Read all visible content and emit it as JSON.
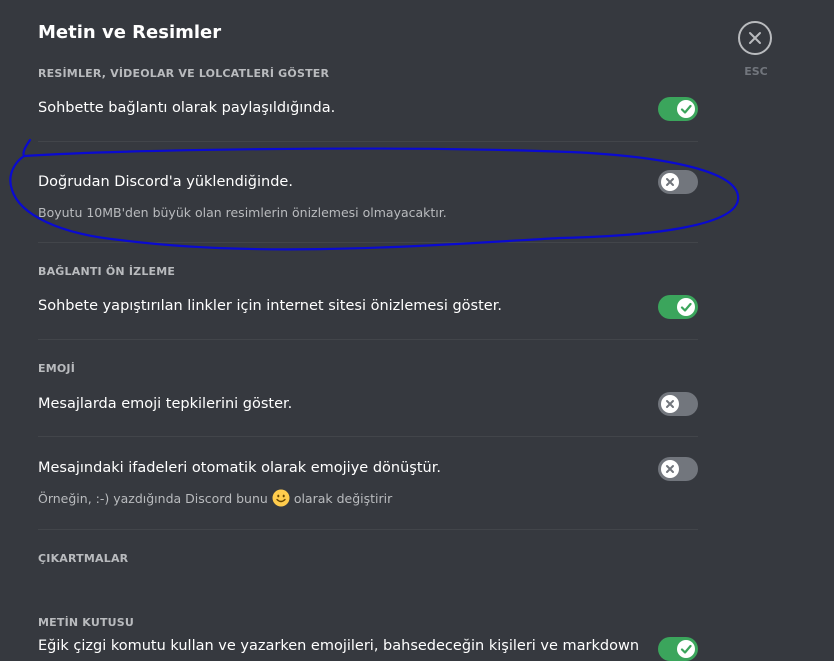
{
  "page": {
    "title": "Metin ve Resimler"
  },
  "close": {
    "esc_label": "ESC",
    "icon": "close-icon"
  },
  "sections": {
    "images": {
      "header": "RESİMLER, VİDEOLAR VE LOLCATLERİ GÖSTER",
      "link_setting": {
        "label": "Sohbette bağlantı olarak paylaşıldığında.",
        "enabled": true
      },
      "upload_setting": {
        "label": "Doğrudan Discord'a yüklendiğinde.",
        "description": "Boyutu 10MB'den büyük olan resimlerin önizlemesi olmayacaktır.",
        "enabled": false
      }
    },
    "link_preview": {
      "header": "BAĞLANTI ÖN İZLEME",
      "preview_setting": {
        "label": "Sohbete yapıştırılan linkler için internet sitesi önizlemesi göster.",
        "enabled": true
      }
    },
    "emoji": {
      "header": "EMOJİ",
      "reactions_setting": {
        "label": "Mesajlarda emoji tepkilerini göster.",
        "enabled": false
      },
      "convert_setting": {
        "label": "Mesajındaki ifadeleri otomatik olarak emojiye dönüştür.",
        "description_before": "Örneğin, :-) yazdığında Discord bunu",
        "description_after": "olarak değiştirir",
        "enabled": false
      }
    },
    "stickers": {
      "header": "ÇIKARTMALAR"
    },
    "textbox": {
      "header": "METİN KUTUSU",
      "slash_setting": {
        "label": "Eğik çizgi komutu kullan ve yazarken emojileri, bahsedeceğin kişileri ve markdown",
        "enabled": true
      }
    }
  },
  "colors": {
    "background": "#36393f",
    "toggle_on": "#3ba55c",
    "toggle_off": "#72767d",
    "annotation": "#0000cc"
  }
}
